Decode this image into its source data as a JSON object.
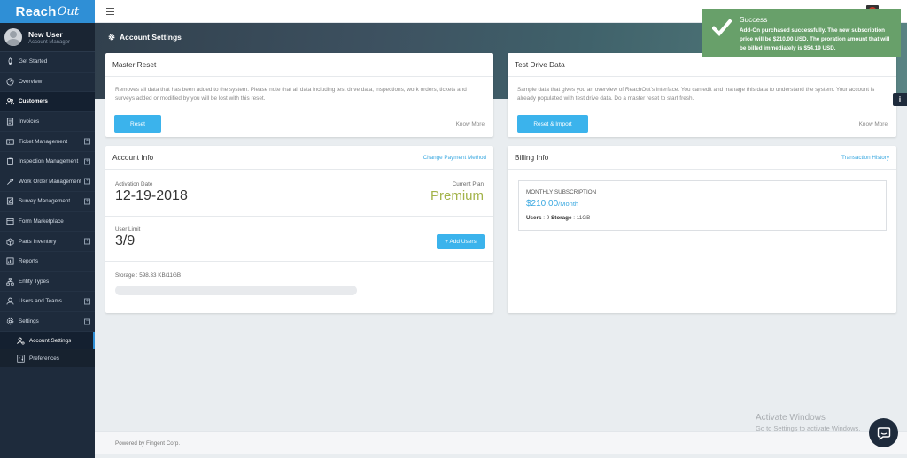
{
  "brand": {
    "name": "Reach",
    "suffix": "Out"
  },
  "user": {
    "name": "New User",
    "role": "Account Manager"
  },
  "sidebar": {
    "items": [
      {
        "label": "Get Started"
      },
      {
        "label": "Overview"
      },
      {
        "label": "Customers"
      },
      {
        "label": "Invoices"
      },
      {
        "label": "Ticket Management"
      },
      {
        "label": "Inspection Management"
      },
      {
        "label": "Work Order Management"
      },
      {
        "label": "Survey Management"
      },
      {
        "label": "Form Marketplace"
      },
      {
        "label": "Parts Inventory"
      },
      {
        "label": "Reports"
      },
      {
        "label": "Entity Types"
      },
      {
        "label": "Users and Teams"
      },
      {
        "label": "Settings"
      }
    ],
    "settings_sub": [
      {
        "label": "Account Settings"
      },
      {
        "label": "Preferences"
      }
    ]
  },
  "header": {
    "title": "Account Settings"
  },
  "master_reset": {
    "title": "Master Reset",
    "description": "Removes all data that has been added to the system. Please note that all data including test drive data, inspections, work orders, tickets and surveys added or modified by you will be lost with this reset.",
    "button": "Reset",
    "know_more": "Know More"
  },
  "test_drive": {
    "title": "Test Drive Data",
    "description": "Sample data that gives you an overview of ReachOut's interface. You can edit and manage this data to understand the system. Your account is already populated with test drive data. Do a master reset to start fresh.",
    "button": "Reset & Import",
    "know_more": "Know More"
  },
  "account_info": {
    "title": "Account Info",
    "link": "Change Payment Method",
    "activation_label": "Activation Date",
    "activation_date": "12-19-2018",
    "plan_label": "Current Plan",
    "plan": "Premium",
    "user_limit_label": "User Limit",
    "user_limit": "3/9",
    "add_users": "+ Add Users",
    "storage_label": "Storage : 598.33 KB/11GB",
    "storage_used_fraction": 0.0
  },
  "billing_info": {
    "title": "Billing Info",
    "link": "Transaction History",
    "subscription_label": "MONTHLY SUBSCRIPTION",
    "price": "$210.00",
    "per": "/Month",
    "users_label": "Users",
    "users_value": ": 9",
    "storage_label": "Storage",
    "storage_value": ": 11GB"
  },
  "footer": {
    "text": "Powered by Fingent Corp."
  },
  "windows": {
    "line1": "Activate Windows",
    "line2": "Go to Settings to activate Windows."
  },
  "toast": {
    "title": "Success",
    "message": "Add-On purchased successfully. The new subscription price will be $210.00 USD. The proration amount that will be billed immediately is $54.19 USD."
  },
  "info_tab": {
    "label": "i"
  },
  "colors": {
    "accent": "#3bb3ec",
    "sidebar": "#1e2b3c",
    "brand": "#2f8fd6",
    "success": "#68a06a",
    "premium": "#a3b34a"
  }
}
